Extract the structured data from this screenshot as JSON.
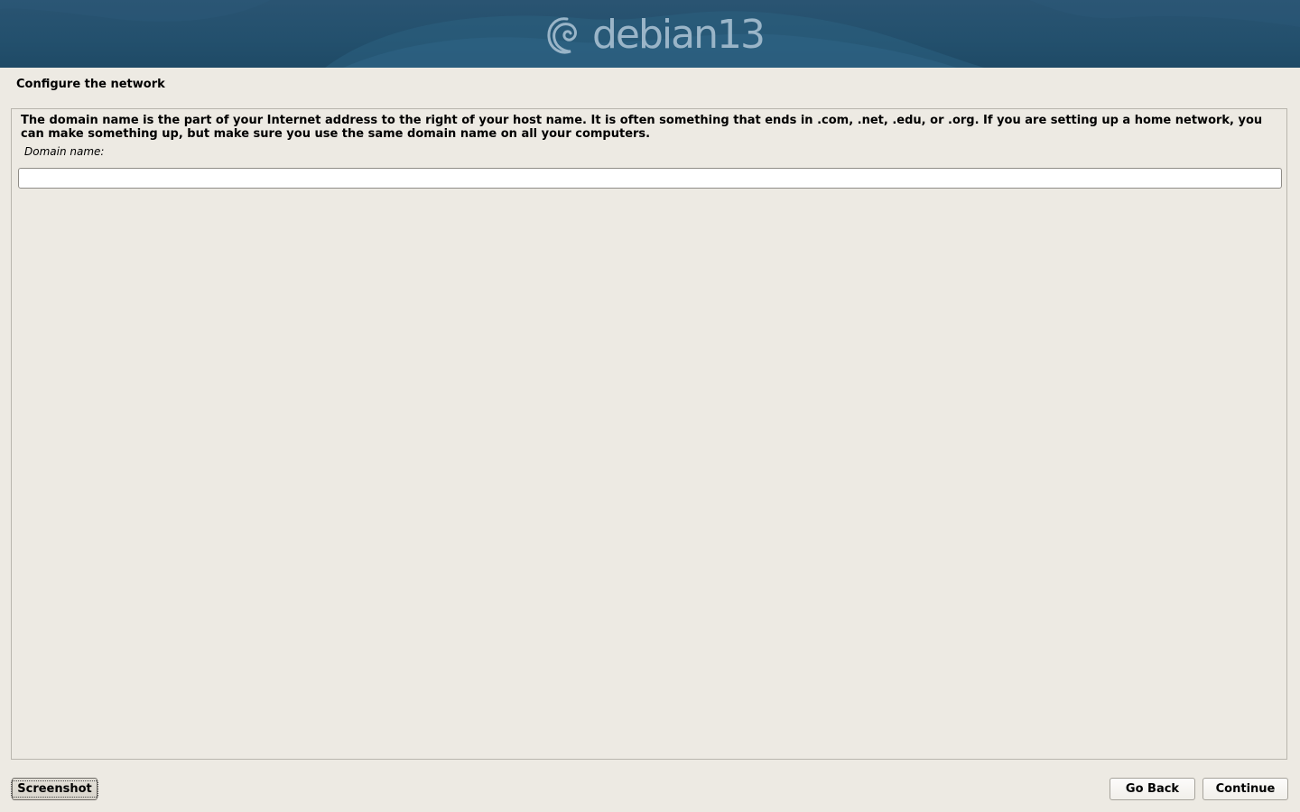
{
  "banner": {
    "brand": "debian",
    "version": "13",
    "logo_icon": "debian-swirl-icon",
    "colors": {
      "background": "#23506d",
      "logo": "#9ab5c8"
    }
  },
  "page": {
    "title": "Configure the network"
  },
  "content": {
    "description": "The domain name is the part of your Internet address to the right of your host name.  It is often something that ends in .com, .net, .edu, or .org.  If you are setting up a home network, you can make something up, but make sure you use the same domain name on all your computers.",
    "field_label": "Domain name:",
    "field_value": ""
  },
  "buttons": {
    "screenshot": "Screenshot",
    "go_back": "Go Back",
    "continue": "Continue"
  }
}
